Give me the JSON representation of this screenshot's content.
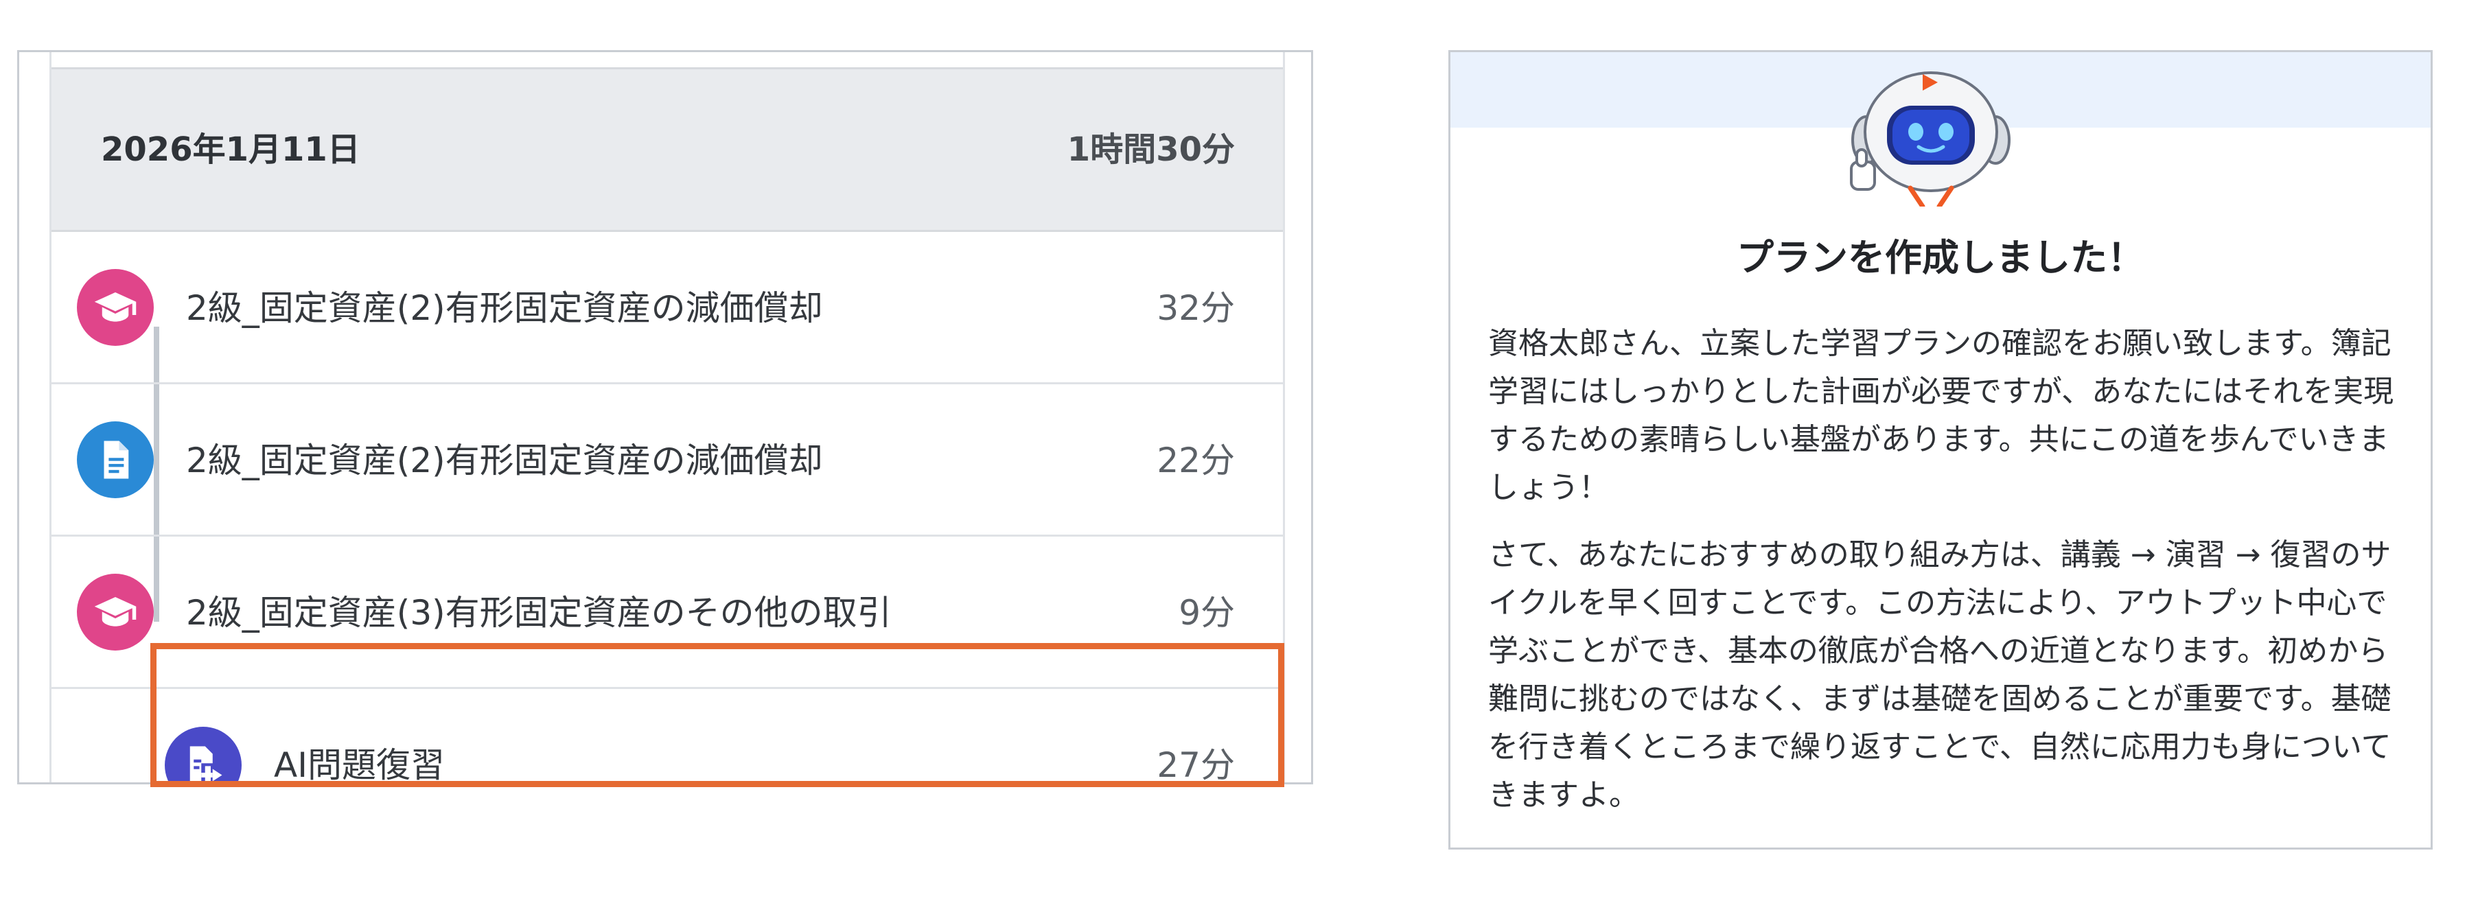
{
  "schedule": {
    "date": "2026年1月11日",
    "total_time": "1時間30分",
    "items": [
      {
        "title": "2級_固定資産(2)有形固定資産の減価償却",
        "minutes": "32分",
        "icon": "graduation-cap-icon",
        "color": "#e0458a"
      },
      {
        "title": "2級_固定資産(2)有形固定資産の減価償却",
        "minutes": "22分",
        "icon": "document-icon",
        "color": "#2a8ad6"
      },
      {
        "title": "2級_固定資産(3)有形固定資産のその他の取引",
        "minutes": "9分",
        "icon": "graduation-cap-icon",
        "color": "#e0458a"
      },
      {
        "title": "AI問題復習",
        "minutes": "27分",
        "icon": "ai-review-icon",
        "color": "#4a4ac8"
      }
    ],
    "highlight_color": "#e56a32"
  },
  "message": {
    "mascot_icon": "robot-mascot-icon",
    "title": "プランを作成しました！",
    "paragraph1": "資格太郎さん、立案した学習プランの確認をお願い致します。簿記学習にはしっかりとした計画が必要ですが、あなたにはそれを実現するための素晴らしい基盤があります。共にこの道を歩んでいきましょう！",
    "paragraph2": "さて、あなたにおすすめの取り組み方は、講義 → 演習 → 復習のサイクルを早く回すことです。この方法により、アウトプット中心で学ぶことができ、基本の徹底が合格への近道となります。初めから難問に挑むのではなく、まずは基礎を固めることが重要です。基礎を行き着くところまで繰り返すことで、自然に応用力も身についてきますよ。"
  }
}
